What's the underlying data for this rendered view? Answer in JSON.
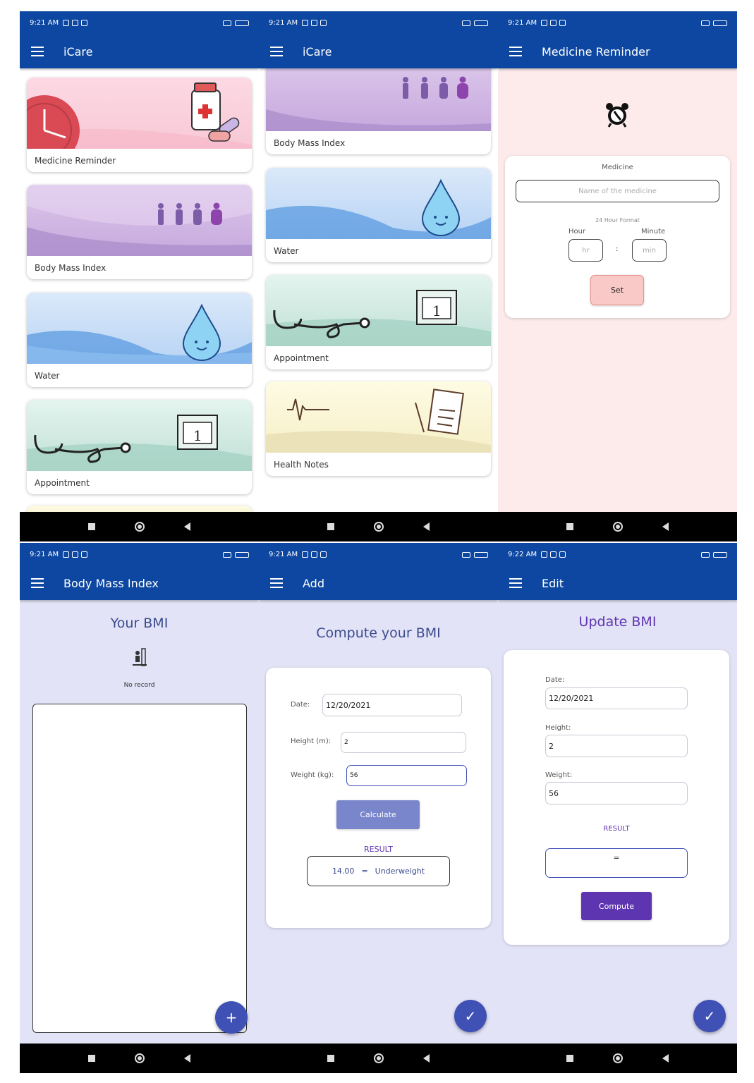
{
  "status": {
    "time_1": "9:21 AM",
    "time_6": "9:22 AM"
  },
  "screen1": {
    "title": "iCare",
    "cards": [
      "Medicine Reminder",
      "Body Mass Index",
      "Water",
      "Appointment"
    ]
  },
  "screen2": {
    "title": "iCare",
    "cards": [
      "Body Mass Index",
      "Water",
      "Appointment",
      "Health Notes"
    ]
  },
  "screen3": {
    "title": "Medicine Reminder",
    "medicine_label": "Medicine",
    "medicine_placeholder": "Name of the medicine",
    "format_label": "24 Hour Format",
    "hour_label": "Hour",
    "minute_label": "Minute",
    "hour_placeholder": "hr",
    "minute_placeholder": "min",
    "separator": ":",
    "set_button": "Set"
  },
  "screen4": {
    "title": "Body Mass Index",
    "heading": "Your BMI",
    "empty_text": "No record",
    "fab": "+"
  },
  "screen5": {
    "title": "Add",
    "heading": "Compute your BMI",
    "date_label": "Date:",
    "date_value": "12/20/2021",
    "height_label": "Height (m):",
    "height_value": "2",
    "weight_label": "Weight (kg):",
    "weight_value": "56",
    "calculate_button": "Calculate",
    "result_label": "RESULT",
    "result_value": "14.00",
    "result_eq": "=",
    "result_category": "Underweight",
    "fab": "✓"
  },
  "screen6": {
    "title": "Edit",
    "heading": "Update BMI",
    "date_label": "Date:",
    "date_value": "12/20/2021",
    "height_label": "Height:",
    "height_value": "2",
    "weight_label": "Weight:",
    "weight_value": "56",
    "result_label": "RESULT",
    "result_value": "=",
    "compute_button": "Compute",
    "fab": "✓"
  },
  "colors": {
    "primary": "#0d47a1",
    "accent": "#3f51b5",
    "purple": "#5e35b1",
    "pink_bg": "#fdebeb",
    "lavender_bg": "#e3e3f7"
  }
}
